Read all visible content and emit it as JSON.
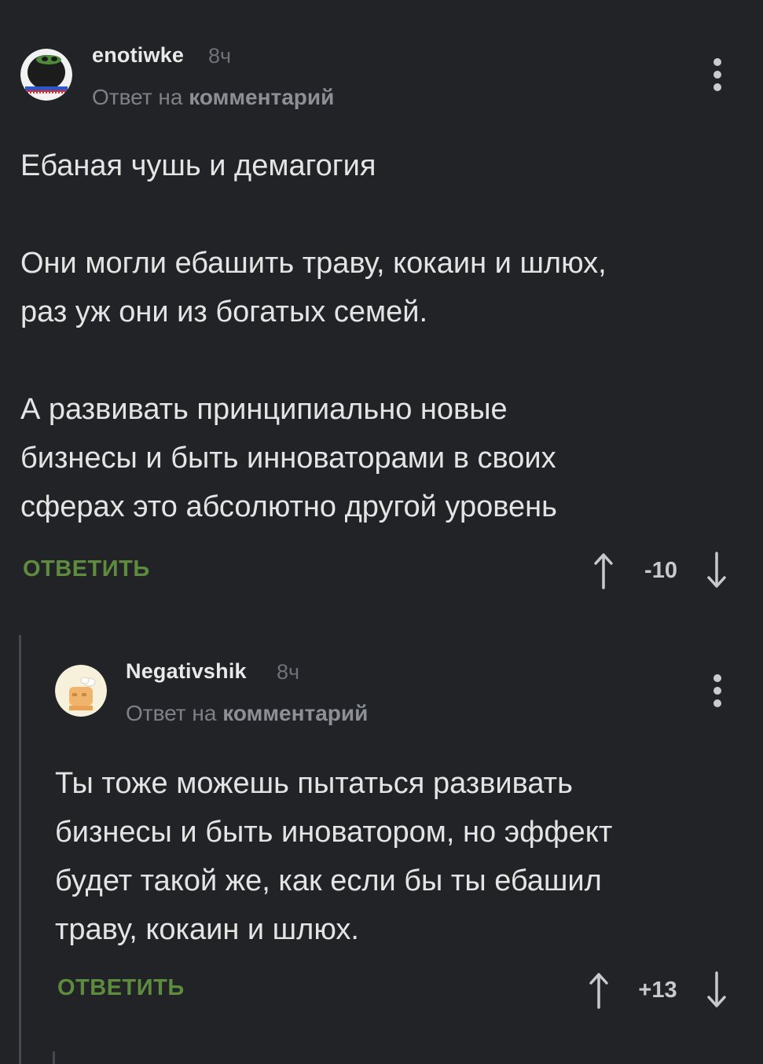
{
  "comments": [
    {
      "username": "enotiwke",
      "time": "8ч",
      "reply_prefix": "Ответ на",
      "reply_link": "комментарий",
      "paragraphs": [
        [
          "Ебаная чушь и демагогия"
        ],
        [
          "Они могли ебашить траву, кокаин и шлюх,",
          "раз уж они из богатых семей."
        ],
        [
          "А развивать принципиально новые",
          "бизнесы и быть инноваторами в своих",
          "сферах это абсолютно другой уровень"
        ]
      ],
      "reply_button": "ОТВЕТИТЬ",
      "score": "-10"
    },
    {
      "username": "Negativshik",
      "time": "8ч",
      "reply_prefix": "Ответ на",
      "reply_link": "комментарий",
      "paragraphs": [
        [
          "Ты тоже можешь пытаться развивать",
          "бизнесы и быть иноватором, но эффект",
          "будет такой же, как если бы ты ебашил",
          "траву, кокаин и шлюх."
        ]
      ],
      "reply_button": "ОТВЕТИТЬ",
      "score": "+13"
    }
  ],
  "colors": {
    "background": "#212326",
    "reply_button": "#5e8c3f",
    "thread_line": "#45484c"
  }
}
